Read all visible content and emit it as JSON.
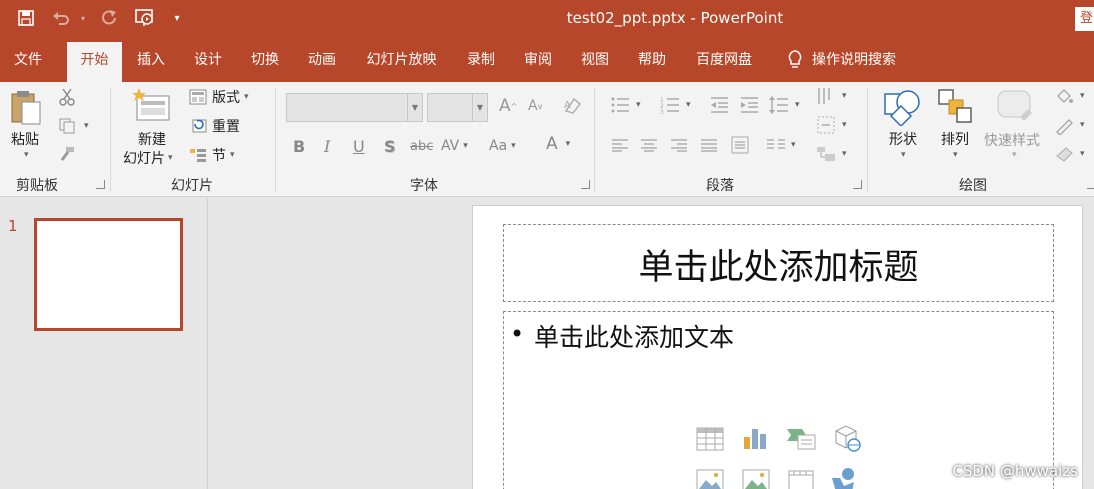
{
  "window": {
    "title": "test02_ppt.pptx  -  PowerPoint",
    "signin_cut": "登"
  },
  "tabs": [
    "文件",
    "开始",
    "插入",
    "设计",
    "切换",
    "动画",
    "幻灯片放映",
    "录制",
    "审阅",
    "视图",
    "帮助",
    "百度网盘"
  ],
  "active_tab": "开始",
  "tell_me": "操作说明搜索",
  "clipboard": {
    "paste": "粘贴",
    "label": "剪贴板"
  },
  "slides_group": {
    "new_line1": "新建",
    "new_line2": "幻灯片",
    "layout": "版式",
    "reset": "重置",
    "section": "节",
    "label": "幻灯片"
  },
  "font_group": {
    "label": "字体",
    "bold": "B",
    "italic": "I",
    "underline": "U",
    "shadow": "S",
    "strike": "abc",
    "spacing": "AV",
    "case": "Aa",
    "color": "A",
    "grow": "A",
    "shrink": "A"
  },
  "paragraph_group": {
    "label": "段落"
  },
  "drawing_group": {
    "shapes": "形状",
    "arrange": "排列",
    "quick_styles": "快速样式",
    "label": "绘图"
  },
  "slide_panel": {
    "number": "1"
  },
  "slide": {
    "title_placeholder": "单击此处添加标题",
    "body_placeholder": "单击此处添加文本",
    "bullet": "•"
  },
  "watermark": "CSDN @hwwaizs",
  "colors": {
    "accent": "#b7472a",
    "ribbon": "#f3f3f3",
    "canvas": "#e6e6e6"
  }
}
